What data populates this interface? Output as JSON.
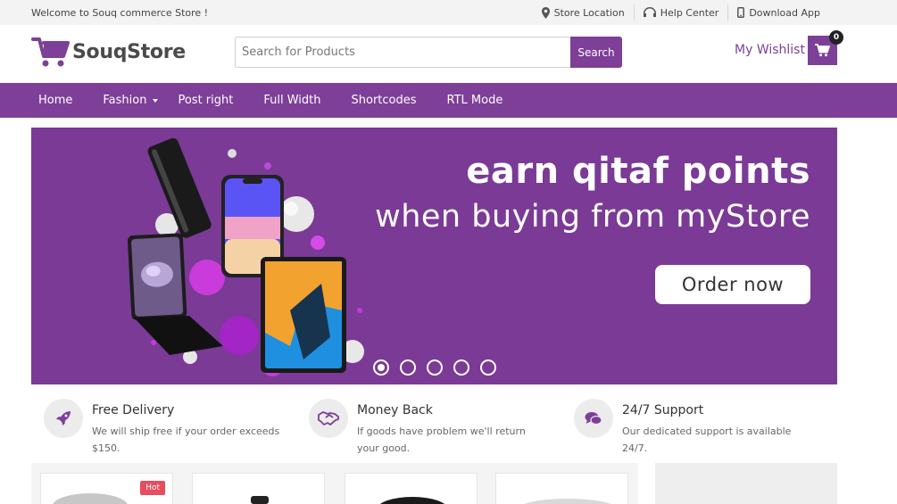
{
  "topbar": {
    "welcome": "Welcome to Souq commerce Store !",
    "store_location": "Store Location",
    "help_center": "Help Center",
    "download_app": "Download App"
  },
  "header": {
    "logo_text": "SouqStore",
    "search_placeholder": "Search for Products",
    "search_button": "Search",
    "wishlist": "My Wishlist",
    "cart_count": "0"
  },
  "nav": {
    "items": [
      {
        "label": "Home"
      },
      {
        "label": "Fashion"
      },
      {
        "label": "Post right"
      },
      {
        "label": "Full Width"
      },
      {
        "label": "Shortcodes"
      },
      {
        "label": "RTL Mode"
      }
    ]
  },
  "banner": {
    "headline": "earn qitaf points",
    "subheadline": "when buying from myStore",
    "cta": "Order now",
    "slide_count": 5,
    "active_slide": 1
  },
  "features": [
    {
      "icon": "rocket-icon",
      "title": "Free Delivery",
      "desc": "We will ship free if your order exceeds $150."
    },
    {
      "icon": "handshake-icon",
      "title": "Money Back",
      "desc": "If goods have problem we'll return your good."
    },
    {
      "icon": "chat-icon",
      "title": "24/7 Support",
      "desc": "Our dedicated support is available 24/7."
    }
  ],
  "products": {
    "hot_badge": "Hot"
  },
  "colors": {
    "brand": "#7d3f98",
    "hot": "#e84c5f"
  }
}
